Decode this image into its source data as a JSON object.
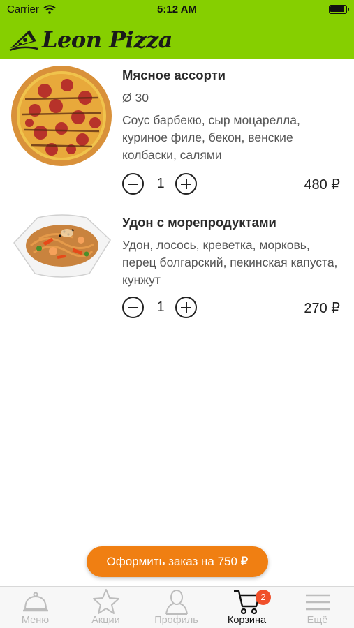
{
  "status_bar": {
    "carrier": "Carrier",
    "time": "5:12 AM"
  },
  "brand": {
    "name": "Leon Pizza"
  },
  "cart": {
    "items": [
      {
        "title": "Мясное ассорти",
        "size": "Ø 30",
        "description": "Соус барбекю, сыр  моцарелла, куриное филе, бекон, венские колбаски, салями",
        "quantity": "1",
        "price": "480 ₽",
        "image": "pizza-image"
      },
      {
        "title": "Удон с морепродуктами",
        "description": "Удон, лосось, креветка, морковь, перец болгарский, пекинская капуста, кунжут",
        "quantity": "1",
        "price": "270 ₽",
        "image": "udon-image"
      }
    ]
  },
  "checkout": {
    "label": "Оформить заказ на 750 ₽"
  },
  "tabs": [
    {
      "label": "Меню",
      "icon": "cloche-icon",
      "active": false
    },
    {
      "label": "Акции",
      "icon": "star-icon",
      "active": false
    },
    {
      "label": "Профиль",
      "icon": "person-icon",
      "active": false
    },
    {
      "label": "Корзина",
      "icon": "cart-icon",
      "active": true,
      "badge": "2"
    },
    {
      "label": "Ещё",
      "icon": "menu-lines-icon",
      "active": false
    }
  ],
  "colors": {
    "header": "#86cf00",
    "accent": "#f07f12",
    "badge": "#f0502a"
  }
}
